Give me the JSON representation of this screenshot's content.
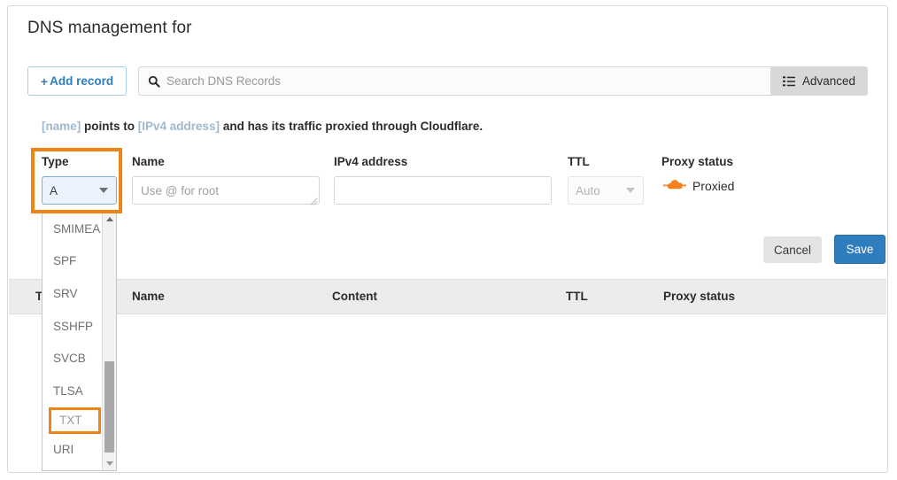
{
  "page": {
    "title": "DNS management for"
  },
  "toolbar": {
    "add_record_label": "Add record",
    "add_record_plus": "+",
    "search_placeholder": "Search DNS Records",
    "search_value": "",
    "advanced_label": "Advanced"
  },
  "description": {
    "token_name": "[name]",
    "mid": " points to ",
    "token_ipv4": "[IPv4 address]",
    "tail": " and has its traffic proxied through Cloudflare."
  },
  "form": {
    "type": {
      "label": "Type",
      "value": "A"
    },
    "name": {
      "label": "Name",
      "placeholder": "Use @ for root",
      "value": ""
    },
    "ipv4": {
      "label": "IPv4 address",
      "placeholder": "",
      "value": ""
    },
    "ttl": {
      "label": "TTL",
      "value": "Auto"
    },
    "proxy": {
      "label": "Proxy status",
      "value": "Proxied"
    }
  },
  "actions": {
    "cancel_label": "Cancel",
    "save_label": "Save"
  },
  "table": {
    "headers": {
      "type": "Type",
      "name": "Name",
      "content": "Content",
      "ttl": "TTL",
      "proxy": "Proxy status"
    },
    "rows": []
  },
  "type_dropdown": {
    "open": true,
    "highlighted": "TXT",
    "options": [
      "SMIMEA",
      "SPF",
      "SRV",
      "SSHFP",
      "SVCB",
      "TLSA",
      "TXT",
      "URI"
    ]
  },
  "colors": {
    "accent_blue": "#2f7dbd",
    "highlight_orange": "#ef8416",
    "cloudflare_orange": "#f48120",
    "header_gray": "#ececec",
    "token_blue": "#9eb9cf"
  }
}
